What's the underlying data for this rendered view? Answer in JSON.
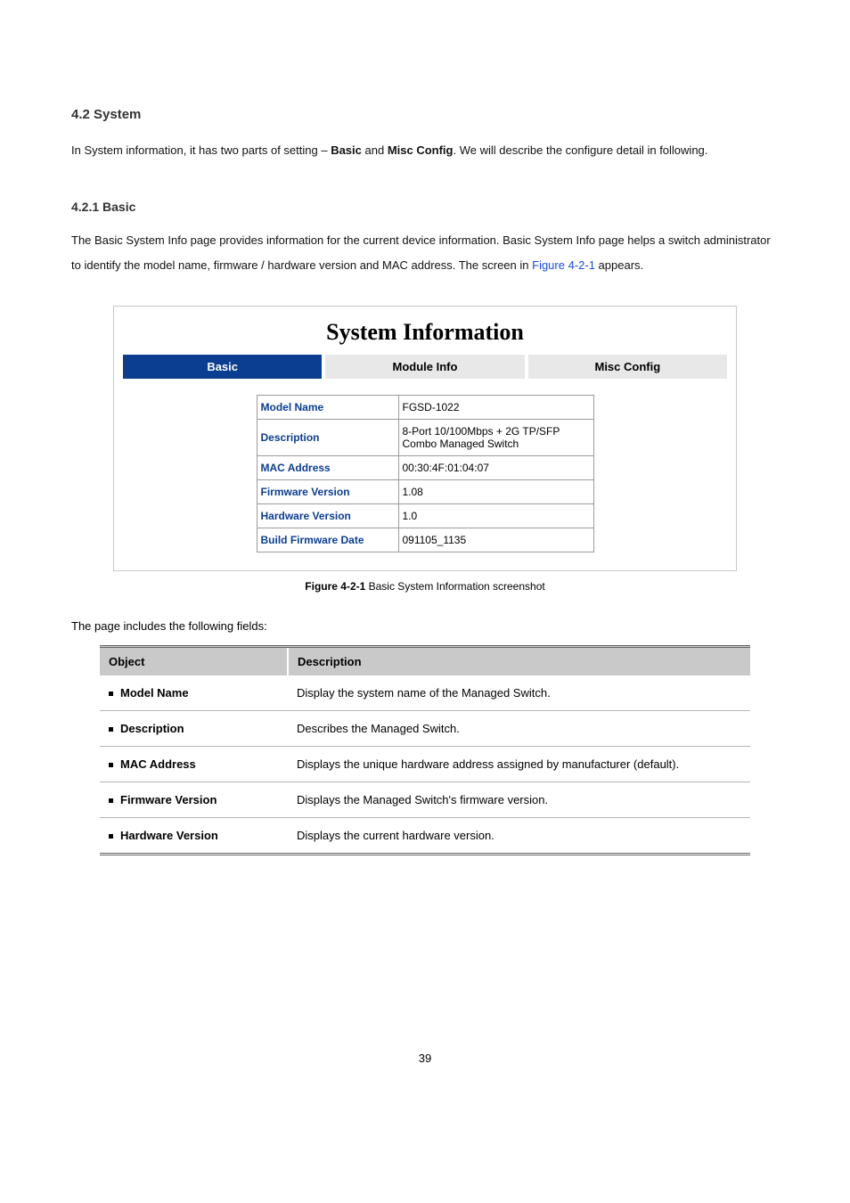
{
  "section": {
    "title": "4.2 System",
    "intro_a": "In System information, it has two parts of setting – ",
    "intro_b_bold": "Basic",
    "intro_c": " and ",
    "intro_d_bold": "Misc Config",
    "intro_e": ". We will describe the configure detail in following."
  },
  "subsection": {
    "title": "4.2.1 Basic",
    "text_a": "The Basic System Info page provides information for the current device information. Basic System Info page helps a switch administrator to identify the model name, firmware / hardware version and MAC address. The screen in ",
    "figure_link": "Figure 4-2-1",
    "text_b": " appears."
  },
  "ui": {
    "title": "System Information",
    "tabs": {
      "basic": "Basic",
      "module": "Module Info",
      "misc": "Misc Config"
    },
    "rows": {
      "model_name": {
        "label": "Model Name",
        "value": "FGSD-1022"
      },
      "description": {
        "label": "Description",
        "value": "8-Port 10/100Mbps + 2G TP/SFP Combo Managed Switch"
      },
      "mac_address": {
        "label": "MAC Address",
        "value": "00:30:4F:01:04:07"
      },
      "firmware_version": {
        "label": "Firmware Version",
        "value": "1.08"
      },
      "hardware_version": {
        "label": "Hardware Version",
        "value": "1.0"
      },
      "build_date": {
        "label": "Build Firmware Date",
        "value": "091105_1135"
      }
    }
  },
  "caption": {
    "prefix": "Figure 4-2-1",
    "text": " Basic System Information screenshot"
  },
  "fields": {
    "intro": "The page includes the following fields:",
    "headers": {
      "object": "Object",
      "description": "Description"
    },
    "rows": {
      "model_name": {
        "label": "Model Name",
        "desc": "Display the system name of the Managed Switch."
      },
      "description": {
        "label": "Description",
        "desc": "Describes the Managed Switch."
      },
      "mac_address": {
        "label": "MAC Address",
        "desc": "Displays the unique hardware address assigned by manufacturer (default)."
      },
      "firmware_version": {
        "label": "Firmware Version",
        "desc": "Displays the Managed Switch's firmware version."
      },
      "hardware_version": {
        "label": "Hardware Version",
        "desc": "Displays the current hardware version."
      }
    }
  },
  "page_number": "39"
}
